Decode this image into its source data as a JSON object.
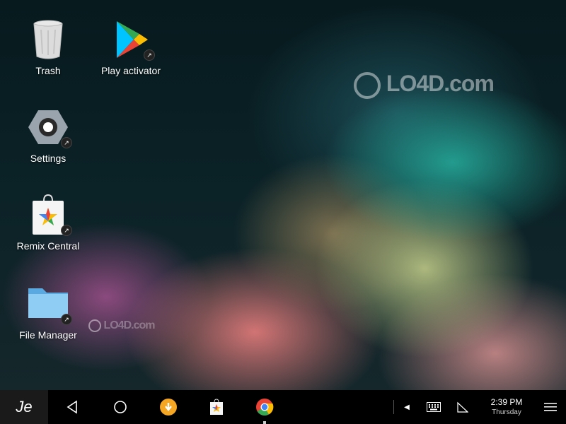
{
  "desktop": {
    "icons": [
      {
        "label": "Trash"
      },
      {
        "label": "Play activator"
      },
      {
        "label": "Settings"
      },
      {
        "label": "Remix Central"
      },
      {
        "label": "File Manager"
      }
    ]
  },
  "watermarks": {
    "top": "LO4D.com",
    "bottom": "LO4D.com"
  },
  "taskbar": {
    "start_logo": "Je",
    "clock": {
      "time": "2:39 PM",
      "day": "Thursday"
    }
  },
  "colors": {
    "taskbar_bg": "#000000",
    "start_bg": "#1a1a1a",
    "folder": "#7cc1f0",
    "settings_hex": "#9aa4ad",
    "download_orange": "#f5a623"
  }
}
